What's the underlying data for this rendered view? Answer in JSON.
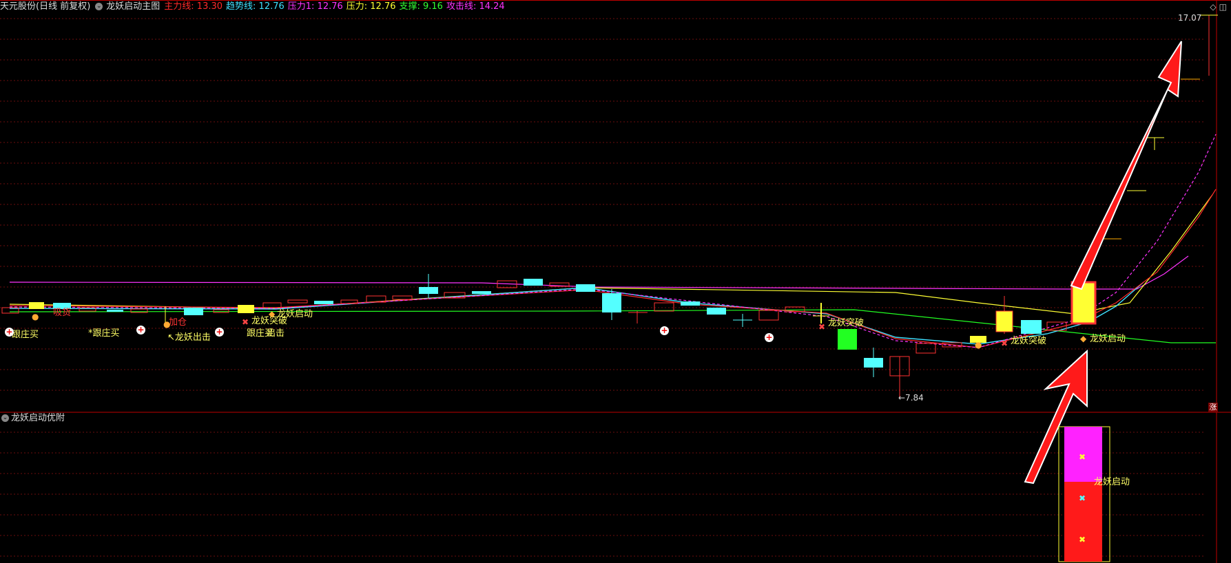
{
  "header": {
    "stock": "天元股份(日线 前复权)",
    "indicator": "龙妖启动主图",
    "values": [
      {
        "label": "主力线: 13.30",
        "color": "#ff2a2a"
      },
      {
        "label": "趋势线: 12.76",
        "color": "#40e0ff"
      },
      {
        "label": "压力1: 12.76",
        "color": "#ff33ff"
      },
      {
        "label": "压力: 12.76",
        "color": "#ffff33"
      },
      {
        "label": "支撑: 9.16",
        "color": "#33ff33"
      },
      {
        "label": "攻击线: 14.24",
        "color": "#ff33ff"
      }
    ]
  },
  "top_right_icons": [
    "◇",
    "◫"
  ],
  "price_high": "17.07",
  "price_low": "←7.84",
  "zhang_badge": "涨",
  "sub_indicator": "龙妖启动优附",
  "signals": [
    {
      "text": "跟庄买",
      "color": "#ffff66"
    },
    {
      "text": "*跟庄买",
      "color": "#ffff66"
    },
    {
      "text": "↖龙妖出击",
      "color": "#ffff66"
    },
    {
      "text": "龙妖突破",
      "color": "#ffff66"
    },
    {
      "text": "跟庄买",
      "color": "#ffff66"
    },
    {
      "text": "出击",
      "color": "#ffff66"
    },
    {
      "text": "龙妖启动",
      "color": "#ffff66"
    },
    {
      "text": "吸货",
      "color": "#ff3333"
    },
    {
      "text": "加仓",
      "color": "#ff3333"
    },
    {
      "text": "龙妖突破",
      "color": "#ffff66"
    },
    {
      "text": "龙妖突破",
      "color": "#ffff66"
    },
    {
      "text": "龙妖启动",
      "color": "#ffff66"
    },
    {
      "text": "龙妖启动",
      "color": "#ffff66"
    }
  ],
  "icons": [
    "plus-circle-icon",
    "money-bag-icon",
    "butterfly-icon",
    "diamond-icon"
  ],
  "colors": {
    "up": "#ff3232",
    "down": "#54ffff",
    "grid": "#7a1010",
    "divider": "#c00000",
    "arrow": "#ff1a1a"
  }
}
